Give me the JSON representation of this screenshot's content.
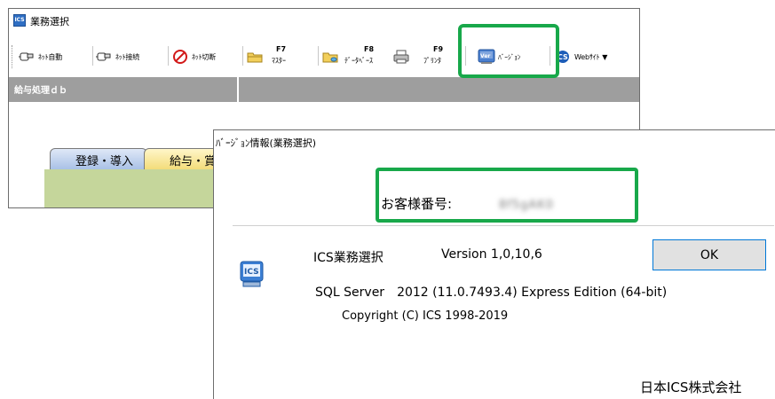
{
  "main_window": {
    "title": "業務選択",
    "app_icon": "ICS",
    "toolbar": [
      {
        "icon": "network-auto-icon",
        "label": "ﾈｯﾄ自動"
      },
      {
        "icon": "network-connect-icon",
        "label": "ﾈｯﾄ接続"
      },
      {
        "icon": "network-disconnect-icon",
        "label": "ﾈｯﾄ切断"
      },
      {
        "icon": "folder-master-icon",
        "key": "F7",
        "label": "ﾏｽﾀｰ"
      },
      {
        "icon": "folder-database-icon",
        "key": "F8",
        "label": "ﾃﾞｰﾀﾍﾞｰｽ"
      },
      {
        "icon": "printer-icon",
        "key": "F9",
        "label": "ﾌﾟﾘﾝﾀ"
      },
      {
        "icon": "version-icon",
        "label": "ﾊﾞｰｼﾞｮﾝ"
      },
      {
        "icon": "ics-web-icon",
        "label": "Webｻｲﾄ"
      }
    ],
    "db_label": "給与処理ｄｂ",
    "tabs": [
      "登録・導入",
      "給与・賞"
    ]
  },
  "dialog": {
    "title": "ﾊﾞｰｼﾞｮﾝ情報(業務選択)",
    "customer_label": "お客様番号:",
    "customer_number_blurred": "8f5gAK0",
    "product": "ICS業務選択",
    "version": "Version 1,0,10,6",
    "ok_label": "OK",
    "sql_server": "SQL Server　2012 (11.0.7493.4) Express Edition (64-bit)",
    "copyright": "Copyright (C) ICS 1998-2019",
    "company": "日本ICS株式会社"
  },
  "colors": {
    "highlight": "#18a84a",
    "db_bar": "#9e9e9e",
    "tab_blue": "#a9c1e6",
    "tab_yellow": "#f3dc7a",
    "tab_body_green": "#c5d69b",
    "ok_border": "#0078d7"
  }
}
